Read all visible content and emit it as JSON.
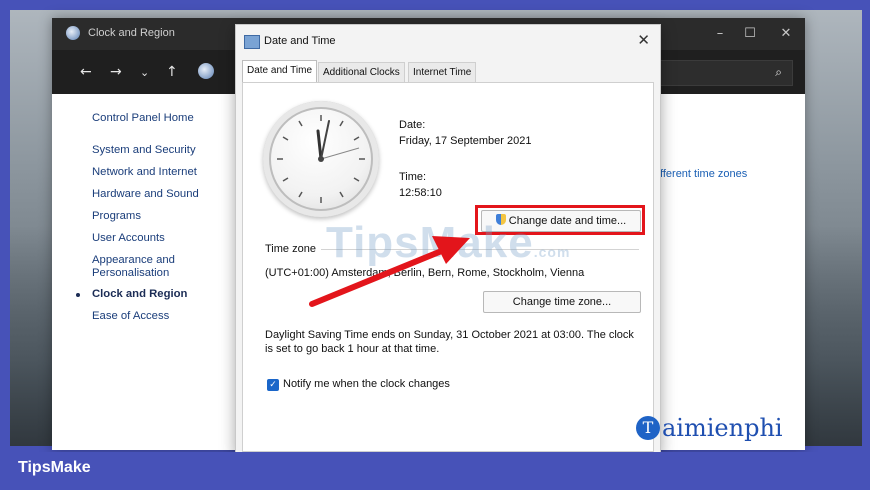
{
  "control_panel": {
    "title": "Clock and Region",
    "sidebar": {
      "items": [
        "Control Panel Home",
        "System and Security",
        "Network and Internet",
        "Hardware and Sound",
        "Programs",
        "User Accounts",
        "Appearance and",
        "Personalisation",
        "Clock and Region",
        "Ease of Access"
      ],
      "selected": "Clock and Region"
    },
    "right_link_fragment": "fferent time zones"
  },
  "dialog": {
    "title": "Date and Time",
    "tabs": [
      "Date and Time",
      "Additional Clocks",
      "Internet Time"
    ],
    "active_tab": "Date and Time",
    "date_label": "Date:",
    "date_value": "Friday, 17 September 2021",
    "time_label": "Time:",
    "time_value": "12:58:10",
    "change_date_button": "Change date and time...",
    "timezone_label": "Time zone",
    "timezone_value": "(UTC+01:00) Amsterdam, Berlin, Bern, Rome, Stockholm, Vienna",
    "change_timezone_button": "Change time zone...",
    "dst_text_line1": "Daylight Saving Time ends on Sunday, 31 October 2021 at 03:00. The clock",
    "dst_text_line2": "is set to go back 1 hour at that time.",
    "notify_label": "Notify me when the clock changes",
    "notify_checked": true
  },
  "watermark": {
    "text": "TipsMake",
    "suffix": ".com"
  },
  "brand_logo": {
    "letter": "T",
    "text": "aimienphi"
  },
  "footer": {
    "label": "TipsMake"
  },
  "colors": {
    "frame": "#4752b8",
    "highlight": "#e3151b",
    "link": "#1a3d7a"
  }
}
